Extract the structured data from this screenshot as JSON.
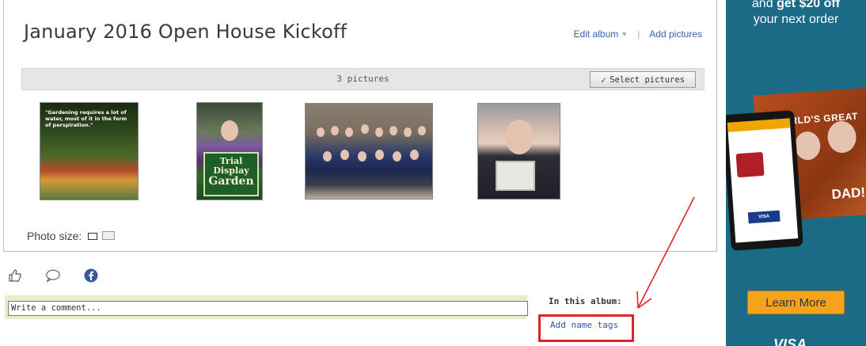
{
  "album": {
    "title": "January 2016 Open House Kickoff",
    "edit_label": "Edit album",
    "caret": "▼",
    "separator": "|",
    "add_pictures_label": "Add pictures",
    "picture_count": "3 pictures",
    "select_pictures_label": "Select pictures",
    "thumbnails": [
      {
        "quote": "\"Gardening requires a lot of water, most of it in the form of perspiration.\""
      },
      {
        "sign_line1": "Trial",
        "sign_line2": "Display",
        "sign_line3": "Garden"
      },
      {},
      {}
    ],
    "photo_size_label": "Photo size:"
  },
  "comments": {
    "placeholder": "Write a comment..."
  },
  "sidebar": {
    "in_this_album": "In this album:",
    "add_name_tags": "Add name tags"
  },
  "ad": {
    "line1_prefix": "and",
    "line1_bold": "get $20 off",
    "line2": "your next order",
    "card_heading": "WORLD'S GREAT",
    "card_dad": "DAD!",
    "tablet_card": "VISA",
    "cta": "Learn More",
    "bottom_text": "VISA"
  },
  "colors": {
    "link": "#3366aa",
    "highlight_box": "#e0242a",
    "ad_background": "#1b6a86",
    "cta_background": "#f7a21b",
    "comment_bar": "#e4f0c8"
  }
}
